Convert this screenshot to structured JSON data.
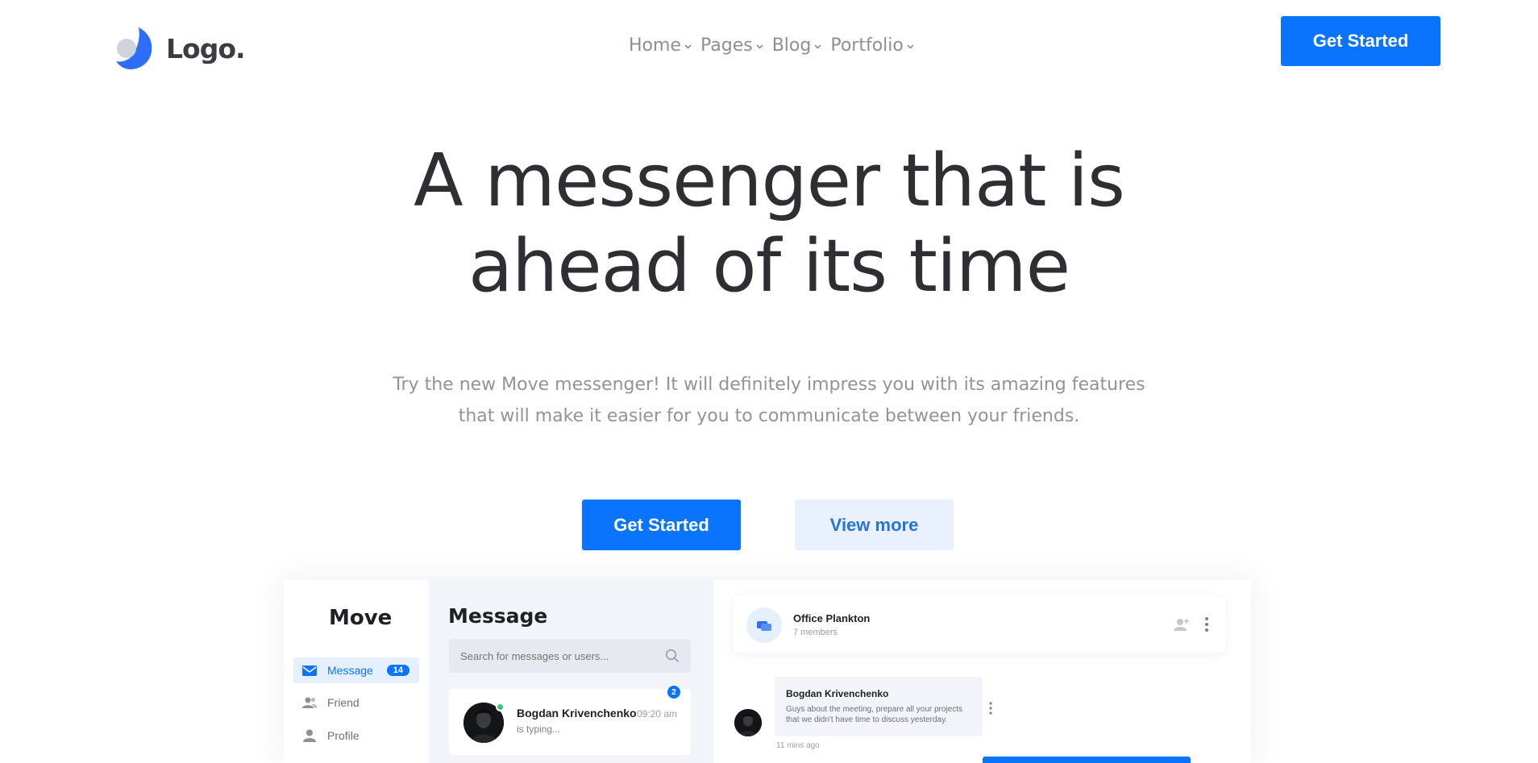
{
  "header": {
    "logo_text": "Logo.",
    "nav": [
      {
        "label": "Home"
      },
      {
        "label": "Pages"
      },
      {
        "label": "Blog"
      },
      {
        "label": "Portfolio"
      }
    ],
    "cta_label": "Get Started"
  },
  "hero": {
    "title_line1": "A messenger that is",
    "title_line2": "ahead of its time",
    "subtitle_line1": "Try the new Move messenger! It will definitely impress you with its amazing features",
    "subtitle_line2": "that will make it easier for you to communicate between your friends.",
    "primary_label": "Get Started",
    "secondary_label": "View more"
  },
  "mockup": {
    "brand": "Move",
    "sidebar": [
      {
        "label": "Message",
        "badge": "14",
        "icon": "mail-icon",
        "active": true
      },
      {
        "label": "Friend",
        "icon": "users-icon",
        "active": false
      },
      {
        "label": "Profile",
        "icon": "user-icon",
        "active": false
      }
    ],
    "list_title": "Message",
    "search_placeholder": "Search for messages or users...",
    "conversation": {
      "name": "Bogdan Krivenchenko",
      "status": "is typing...",
      "time": "09:20 am",
      "unread": "2"
    },
    "chat": {
      "group_name": "Office Plankton",
      "members": "7 members",
      "message": {
        "sender": "Bogdan Krivenchenko",
        "text": "Guys about the meeting, prepare all your projects that we didn't have time to discuss yesterday.",
        "time": "11 mins ago"
      }
    }
  },
  "colors": {
    "accent": "#0b74ff",
    "secondary_bg": "#e8f1fd",
    "text_dark": "#2f2f33",
    "text_muted": "#8f949c"
  }
}
